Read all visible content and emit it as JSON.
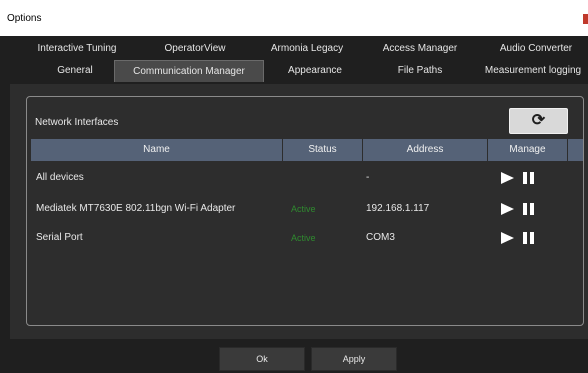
{
  "window": {
    "title": "Options"
  },
  "tabs": {
    "row1": [
      "Interactive Tuning",
      "OperatorView",
      "Armonia Legacy",
      "Access Manager",
      "Audio Converter"
    ],
    "row2": [
      "General",
      "Communication Manager",
      "Appearance",
      "File Paths",
      "Measurement logging"
    ],
    "active": "Communication Manager"
  },
  "panel": {
    "title": "Network Interfaces",
    "refresh_icon": "refresh-icon"
  },
  "table": {
    "headers": {
      "name": "Name",
      "status": "Status",
      "address": "Address",
      "manage": "Manage"
    },
    "rows": [
      {
        "name": "All devices",
        "status": "",
        "address": "-"
      },
      {
        "name": "Mediatek MT7630E 802.11bgn Wi-Fi Adapter",
        "status": "Active",
        "address": "192.168.1.117"
      },
      {
        "name": "Serial Port",
        "status": "Active",
        "address": "COM3"
      }
    ]
  },
  "footer": {
    "ok_label": "Ok",
    "apply_label": "Apply"
  },
  "colors": {
    "header_bg": "#556277",
    "status_active": "#2f8a2f",
    "window_bg": "#1f1f1f",
    "panel_bg": "#2d2d2d"
  }
}
